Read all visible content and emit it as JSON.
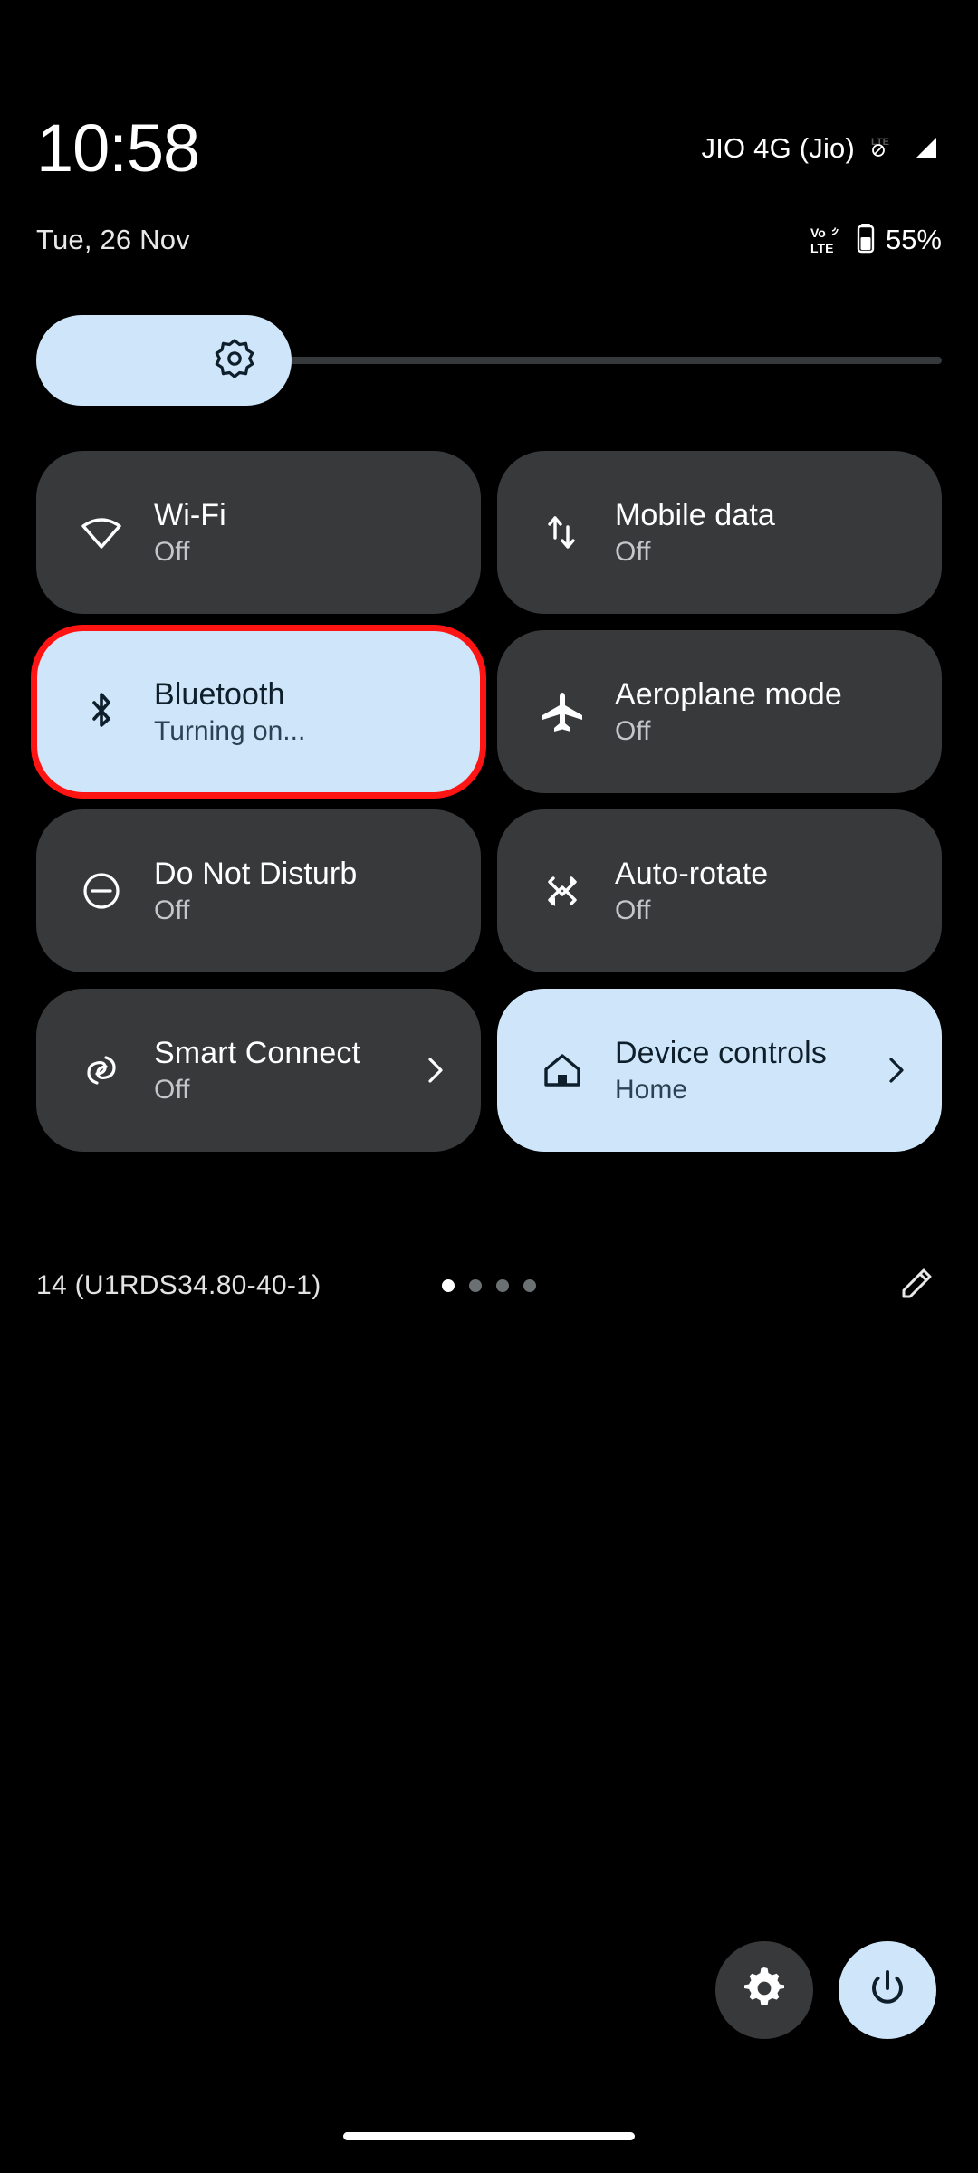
{
  "status_bar": {
    "time": "10:58",
    "date": "Tue, 26 Nov",
    "carrier": "JIO 4G (Jio)",
    "lte_icon": "lte-no-data-icon",
    "signal_icon": "signal-bars-icon",
    "volte_top": "Vo",
    "volte_bottom": "LTE",
    "battery_percent": "55%"
  },
  "brightness": {
    "icon": "brightness-sun-icon",
    "level_percent": 28,
    "label": "Brightness"
  },
  "tiles": [
    {
      "label": "Wi-Fi",
      "state": "Off",
      "icon": "wifi-icon",
      "active": false,
      "chevron": false,
      "highlighted": false
    },
    {
      "label": "Mobile data",
      "state": "Off",
      "icon": "mobile-data-icon",
      "active": false,
      "chevron": false,
      "highlighted": false
    },
    {
      "label": "Bluetooth",
      "state": "Turning on...",
      "icon": "bluetooth-icon",
      "active": true,
      "chevron": false,
      "highlighted": true
    },
    {
      "label": "Aeroplane mode",
      "state": "Off",
      "icon": "airplane-icon",
      "active": false,
      "chevron": false,
      "highlighted": false
    },
    {
      "label": "Do Not Disturb",
      "state": "Off",
      "icon": "do-not-disturb-icon",
      "active": false,
      "chevron": false,
      "highlighted": false
    },
    {
      "label": "Auto-rotate",
      "state": "Off",
      "icon": "auto-rotate-icon",
      "active": false,
      "chevron": false,
      "highlighted": false
    },
    {
      "label": "Smart Connect",
      "state": "Off",
      "icon": "smart-connect-icon",
      "active": false,
      "chevron": true,
      "highlighted": false
    },
    {
      "label": "Device controls",
      "state": "Home",
      "icon": "home-icon",
      "active": true,
      "chevron": true,
      "highlighted": false
    }
  ],
  "footer": {
    "build": "14 (U1RDS34.80-40-1)",
    "page_count": 4,
    "active_page": 1,
    "edit_icon": "pencil-edit-icon"
  },
  "bottom_actions": {
    "settings_icon": "gear-icon",
    "power_icon": "power-icon"
  },
  "colors": {
    "accent_light": "#cfe6fa",
    "tile_bg": "#37393b",
    "highlight": "#ff1414",
    "background": "#000000"
  }
}
